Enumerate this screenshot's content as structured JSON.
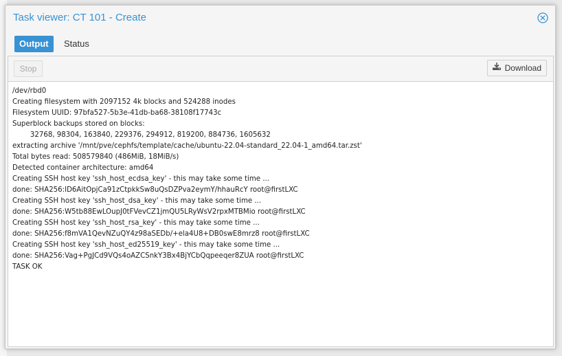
{
  "window": {
    "title": "Task viewer: CT 101 - Create"
  },
  "tabs": [
    {
      "label": "Output",
      "active": true
    },
    {
      "label": "Status",
      "active": false
    }
  ],
  "toolbar": {
    "stop_label": "Stop",
    "download_label": "Download"
  },
  "icons": {
    "close": "close-circle-icon",
    "download": "download-icon"
  },
  "colors": {
    "accent": "#3892d4",
    "panel_bg": "#ffffff",
    "window_bg": "#f5f5f5"
  },
  "log_lines": [
    "/dev/rbd0",
    "Creating filesystem with 2097152 4k blocks and 524288 inodes",
    "Filesystem UUID: 97bfa527-5b3e-41db-ba68-38108f17743c",
    "Superblock backups stored on blocks:",
    "        32768, 98304, 163840, 229376, 294912, 819200, 884736, 1605632",
    "extracting archive '/mnt/pve/cephfs/template/cache/ubuntu-22.04-standard_22.04-1_amd64.tar.zst'",
    "Total bytes read: 508579840 (486MiB, 18MiB/s)",
    "Detected container architecture: amd64",
    "Creating SSH host key 'ssh_host_ecdsa_key' - this may take some time ...",
    "done: SHA256:ID6AitOpjCa91zCtpkkSw8uQsDZPva2eymY/hhauRcY root@firstLXC",
    "Creating SSH host key 'ssh_host_dsa_key' - this may take some time ...",
    "done: SHA256:W5tb88EwLOupJ0tFVevCZ1jmQU5LRyWsV2rpxMTBMio root@firstLXC",
    "Creating SSH host key 'ssh_host_rsa_key' - this may take some time ...",
    "done: SHA256:f8mVA1QevNZuQY4z98aSEDb/+ela4U8+DB0swE8mrz8 root@firstLXC",
    "Creating SSH host key 'ssh_host_ed25519_key' - this may take some time ...",
    "done: SHA256:Vag+PgJCd9VQs4oAZCSnkY3Bx4BjYCbQqpeeqer8ZUA root@firstLXC",
    "TASK OK"
  ]
}
